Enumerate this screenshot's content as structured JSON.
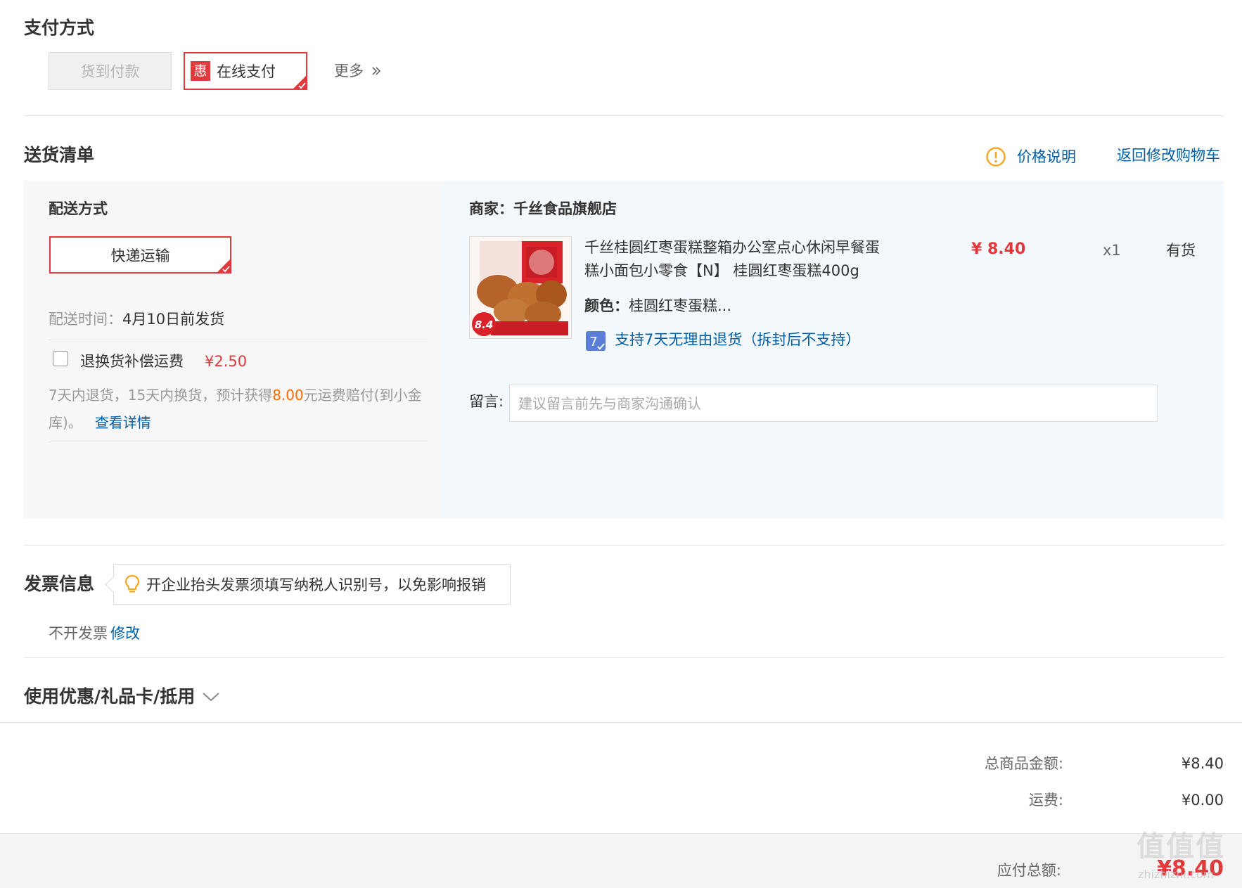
{
  "payment": {
    "title": "支付方式",
    "cod_label": "货到付款",
    "online_badge": "惠",
    "online_label": "在线支付",
    "selected": "在线支付",
    "more_label": "更多",
    "more_icon": "double-chevron-right-icon"
  },
  "delivery": {
    "title": "送货清单",
    "price_note": "价格说明",
    "price_note_icon": "warning-circle-icon",
    "back_to_cart": "返回修改购物车",
    "shipping": {
      "title": "配送方式",
      "method": "快递运输",
      "time_label": "配送时间：",
      "time_value": "4月10日前发货",
      "insurance": {
        "checked": false,
        "label": "退换货补偿运费",
        "price": "¥2.50",
        "desc_before": "7天内退货，15天内换货，预计获得",
        "desc_amount": "8.00",
        "desc_after": "元运费赔付(到小金库)。",
        "detail_link": "查看详情"
      }
    },
    "shop": {
      "label": "商家：",
      "name": "千丝食品旗舰店"
    },
    "product": {
      "title": "千丝桂圆红枣蛋糕整箱办公室点心休闲早餐蛋糕小面包小零食【N】 桂圆红枣蛋糕400g",
      "price": "¥ 8.40",
      "qty": "x1",
      "stock": "有货",
      "color_label": "颜色：",
      "color_value": "桂圆红枣蛋糕...",
      "image_badge": "8.4",
      "return_badge": "7",
      "return_policy": "支持7天无理由退货（拆封后不支持）"
    },
    "message": {
      "label": "留言:",
      "placeholder": "建议留言前先与商家沟通确认"
    }
  },
  "invoice": {
    "title": "发票信息",
    "tip": "开企业抬头发票须填写纳税人识别号，以免影响报销",
    "tip_icon": "lightbulb-icon",
    "status": "不开发票",
    "edit_link": "修改"
  },
  "coupon": {
    "title": "使用优惠/礼品卡/抵用",
    "icon": "chevron-down-icon"
  },
  "summary": {
    "goods_label": "总商品金额:",
    "goods_value": "¥8.40",
    "shipping_label": "运费:",
    "shipping_value": "¥0.00",
    "total_label": "应付总额:",
    "total_value": "¥8.40"
  },
  "watermark": {
    "logo": "值值值",
    "site": "zhizhizhi.com"
  },
  "colors": {
    "accent": "#e4393c",
    "link": "#005ea7",
    "highlight": "#ff6a00",
    "panel_gray": "#f7f7f7",
    "panel_blue": "#f3f8fc",
    "warning": "#f5a623"
  }
}
